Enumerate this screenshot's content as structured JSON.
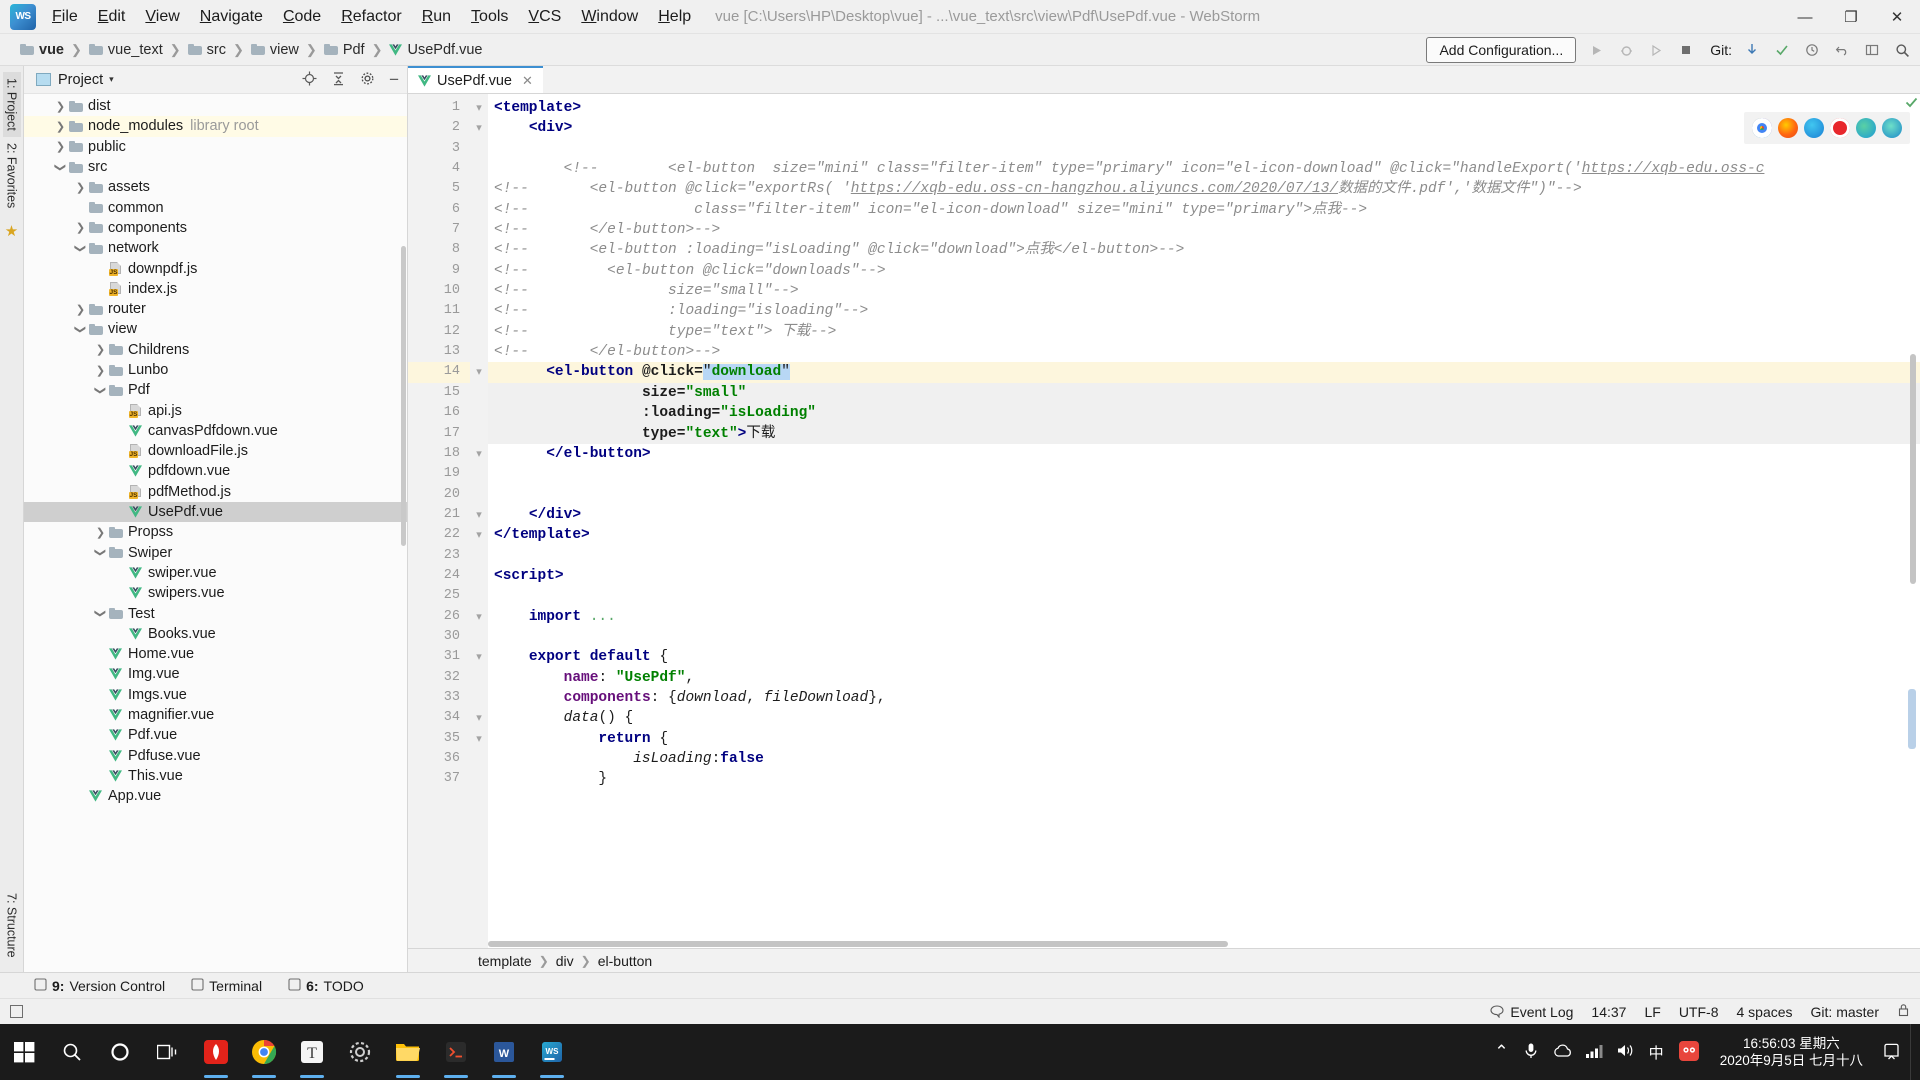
{
  "window": {
    "app_name": "WebStorm",
    "title": "vue [C:\\Users\\HP\\Desktop\\vue] - ...\\vue_text\\src\\view\\Pdf\\UsePdf.vue - WebStorm",
    "logo_text": "WS",
    "minimize": "—",
    "maximize": "❐",
    "close": "✕"
  },
  "menu": [
    "File",
    "Edit",
    "View",
    "Navigate",
    "Code",
    "Refactor",
    "Run",
    "Tools",
    "VCS",
    "Window",
    "Help"
  ],
  "breadcrumb": [
    {
      "label": "vue",
      "icon": "folder-icon",
      "bold": true
    },
    {
      "label": "vue_text",
      "icon": "folder-icon",
      "bold": false
    },
    {
      "label": "src",
      "icon": "folder-icon",
      "bold": false
    },
    {
      "label": "view",
      "icon": "folder-icon",
      "bold": false
    },
    {
      "label": "Pdf",
      "icon": "folder-icon",
      "bold": false
    },
    {
      "label": "UsePdf.vue",
      "icon": "vue-icon",
      "bold": false
    }
  ],
  "toolbar": {
    "add_configuration": "Add Configuration...",
    "run_icon": "run-icon",
    "debug_icon": "debug-icon",
    "coverage_icon": "coverage-icon",
    "stop_icon": "stop-icon",
    "git_label": "Git:",
    "git_update_icon": "update-project-icon",
    "git_commit_icon": "commit-icon",
    "git_history_icon": "history-icon",
    "undo_icon": "undo-icon",
    "layout_icon": "layout-icon",
    "search_icon": "search-icon"
  },
  "left_strip": {
    "tabs": [
      {
        "label": "1: Project",
        "selected": true
      },
      {
        "label": "2: Favorites",
        "selected": false
      }
    ],
    "bottom_tab": "7: Structure",
    "star_icon": "favorites-star-icon"
  },
  "project_panel": {
    "title": "Project",
    "caret": "▾",
    "locate_icon": "locate-icon",
    "collapse_icon": "collapse-all-icon",
    "settings_icon": "gear-icon",
    "hide_icon": "hide-icon",
    "tree": [
      {
        "label": "dist",
        "type": "folder",
        "indent": 1,
        "arrow": "right",
        "state": "normal"
      },
      {
        "label": "node_modules",
        "type": "folder",
        "indent": 1,
        "arrow": "right",
        "state": "highlight",
        "suffix": "library root"
      },
      {
        "label": "public",
        "type": "folder",
        "indent": 1,
        "arrow": "right",
        "state": "normal"
      },
      {
        "label": "src",
        "type": "folder",
        "indent": 1,
        "arrow": "down",
        "state": "normal"
      },
      {
        "label": "assets",
        "type": "folder",
        "indent": 2,
        "arrow": "right",
        "state": "normal"
      },
      {
        "label": "common",
        "type": "folder",
        "indent": 2,
        "arrow": "none",
        "state": "normal"
      },
      {
        "label": "components",
        "type": "folder",
        "indent": 2,
        "arrow": "right",
        "state": "normal"
      },
      {
        "label": "network",
        "type": "folder",
        "indent": 2,
        "arrow": "down",
        "state": "normal"
      },
      {
        "label": "downpdf.js",
        "type": "js",
        "indent": 3,
        "arrow": "none",
        "state": "normal"
      },
      {
        "label": "index.js",
        "type": "js",
        "indent": 3,
        "arrow": "none",
        "state": "normal"
      },
      {
        "label": "router",
        "type": "folder",
        "indent": 2,
        "arrow": "right",
        "state": "normal"
      },
      {
        "label": "view",
        "type": "folder",
        "indent": 2,
        "arrow": "down",
        "state": "normal"
      },
      {
        "label": "Childrens",
        "type": "folder",
        "indent": 3,
        "arrow": "right",
        "state": "normal"
      },
      {
        "label": "Lunbo",
        "type": "folder",
        "indent": 3,
        "arrow": "right",
        "state": "normal"
      },
      {
        "label": "Pdf",
        "type": "folder",
        "indent": 3,
        "arrow": "down",
        "state": "normal"
      },
      {
        "label": "api.js",
        "type": "js",
        "indent": 4,
        "arrow": "none",
        "state": "normal"
      },
      {
        "label": "canvasPdfdown.vue",
        "type": "vue",
        "indent": 4,
        "arrow": "none",
        "state": "normal"
      },
      {
        "label": "downloadFile.js",
        "type": "js",
        "indent": 4,
        "arrow": "none",
        "state": "normal"
      },
      {
        "label": "pdfdown.vue",
        "type": "vue",
        "indent": 4,
        "arrow": "none",
        "state": "normal"
      },
      {
        "label": "pdfMethod.js",
        "type": "js",
        "indent": 4,
        "arrow": "none",
        "state": "normal"
      },
      {
        "label": "UsePdf.vue",
        "type": "vue",
        "indent": 4,
        "arrow": "none",
        "state": "selected"
      },
      {
        "label": "Propss",
        "type": "folder",
        "indent": 3,
        "arrow": "right",
        "state": "normal"
      },
      {
        "label": "Swiper",
        "type": "folder",
        "indent": 3,
        "arrow": "down",
        "state": "normal"
      },
      {
        "label": "swiper.vue",
        "type": "vue",
        "indent": 4,
        "arrow": "none",
        "state": "normal"
      },
      {
        "label": "swipers.vue",
        "type": "vue",
        "indent": 4,
        "arrow": "none",
        "state": "normal"
      },
      {
        "label": "Test",
        "type": "folder",
        "indent": 3,
        "arrow": "down",
        "state": "normal"
      },
      {
        "label": "Books.vue",
        "type": "vue",
        "indent": 4,
        "arrow": "none",
        "state": "normal"
      },
      {
        "label": "Home.vue",
        "type": "vue",
        "indent": 3,
        "arrow": "none",
        "state": "normal"
      },
      {
        "label": "Img.vue",
        "type": "vue",
        "indent": 3,
        "arrow": "none",
        "state": "normal"
      },
      {
        "label": "Imgs.vue",
        "type": "vue",
        "indent": 3,
        "arrow": "none",
        "state": "normal"
      },
      {
        "label": "magnifier.vue",
        "type": "vue",
        "indent": 3,
        "arrow": "none",
        "state": "normal"
      },
      {
        "label": "Pdf.vue",
        "type": "vue",
        "indent": 3,
        "arrow": "none",
        "state": "normal"
      },
      {
        "label": "Pdfuse.vue",
        "type": "vue",
        "indent": 3,
        "arrow": "none",
        "state": "normal"
      },
      {
        "label": "This.vue",
        "type": "vue",
        "indent": 3,
        "arrow": "none",
        "state": "normal"
      },
      {
        "label": "App.vue",
        "type": "vue",
        "indent": 2,
        "arrow": "none",
        "state": "normal"
      }
    ]
  },
  "editor": {
    "tab": {
      "label": "UsePdf.vue",
      "icon": "vue-icon",
      "close": "✕"
    },
    "current_line": 14,
    "breadcrumb": [
      "template",
      "div",
      "el-button"
    ],
    "inspection_ok_icon": "inspection-ok-icon",
    "lines": [
      {
        "n": 1,
        "fold": "-",
        "html": "<span class='tag'>&lt;template&gt;</span>"
      },
      {
        "n": 2,
        "fold": "-",
        "html": "    <span class='tag'>&lt;div&gt;</span>"
      },
      {
        "n": 3,
        "fold": "",
        "html": ""
      },
      {
        "n": 4,
        "fold": "",
        "html": "        <span class='cm'>&lt;!--        &lt;el-button  size=\"mini\" class=\"filter-item\" type=\"primary\" icon=\"el-icon-download\" @click=\"handleExport('<u>https://xqb-edu.oss-c</u></span>"
      },
      {
        "n": 5,
        "fold": "",
        "html": "<span class='cm'>&lt;!--</span>       <span class='cm'>&lt;el-button @click=\"exportRs( '<u>https://xqb-edu.oss-cn-hangzhou.aliyuncs.com/2020/07/13/</u>数据的文件.pdf','数据文件\")\"--&gt;</span>"
      },
      {
        "n": 6,
        "fold": "",
        "html": "<span class='cm'>&lt;!--</span>                   <span class='cm'>class=\"filter-item\" icon=\"el-icon-download\" size=\"mini\" type=\"primary\"&gt;点我--&gt;</span>"
      },
      {
        "n": 7,
        "fold": "",
        "html": "<span class='cm'>&lt;!--</span>       <span class='cm'>&lt;/el-button&gt;--&gt;</span>"
      },
      {
        "n": 8,
        "fold": "",
        "html": "<span class='cm'>&lt;!--</span>       <span class='cm'>&lt;el-button :loading=\"isLoading\" @click=\"download\"&gt;点我&lt;/el-button&gt;--&gt;</span>"
      },
      {
        "n": 9,
        "fold": "",
        "html": "<span class='cm'>&lt;!--</span>         <span class='cm'>&lt;el-button @click=\"downloads\"--&gt;</span>"
      },
      {
        "n": 10,
        "fold": "",
        "html": "<span class='cm'>&lt;!--</span>                <span class='cm'>size=\"small\"--&gt;</span>"
      },
      {
        "n": 11,
        "fold": "",
        "html": "<span class='cm'>&lt;!--</span>                <span class='cm'>:loading=\"isloading\"--&gt;</span>"
      },
      {
        "n": 12,
        "fold": "",
        "html": "<span class='cm'>&lt;!--</span>                <span class='cm'>type=\"text\"&gt; 下载--&gt;</span>"
      },
      {
        "n": 13,
        "fold": "",
        "html": "<span class='cm'>&lt;!--</span>       <span class='cm'>&lt;/el-button&gt;--&gt;</span>"
      },
      {
        "n": 14,
        "fold": "-",
        "current": true,
        "html": "      <span class='tag'>&lt;el-button</span> <span class='attr'>@click=</span><span class='sel-tok'>\"</span><span class='str sel-tok'>download</span><span class='sel-tok'>\"</span>"
      },
      {
        "n": 15,
        "fold": "",
        "shade": true,
        "html": "                 <span class='attr'>size=</span><span class='str'>\"small\"</span>"
      },
      {
        "n": 16,
        "fold": "",
        "shade": true,
        "html": "                 <span class='attr'>:loading=</span><span class='str'>\"isLoading\"</span>"
      },
      {
        "n": 17,
        "fold": "",
        "shade": true,
        "html": "                 <span class='attr'>type=</span><span class='str'>\"text\"</span><span class='tag'>&gt;</span>下载"
      },
      {
        "n": 18,
        "fold": "-",
        "html": "      <span class='tag'>&lt;/el-button&gt;</span>"
      },
      {
        "n": 19,
        "fold": "",
        "html": ""
      },
      {
        "n": 20,
        "fold": "",
        "html": ""
      },
      {
        "n": 21,
        "fold": "-",
        "html": "    <span class='tag'>&lt;/div&gt;</span>"
      },
      {
        "n": 22,
        "fold": "-",
        "html": "<span class='tag'>&lt;/template&gt;</span>"
      },
      {
        "n": 23,
        "fold": "",
        "html": ""
      },
      {
        "n": 24,
        "fold": "",
        "html": "<span class='tag'>&lt;script&gt;</span>"
      },
      {
        "n": 25,
        "fold": "",
        "html": ""
      },
      {
        "n": 26,
        "fold": "-",
        "html": "    <span class='kw'>import</span> <span class='cm' style='font-style:normal;color:#59a869'>...</span>"
      },
      {
        "n": 30,
        "fold": "",
        "html": ""
      },
      {
        "n": 31,
        "fold": "-",
        "html": "    <span class='kw'>export default</span> {"
      },
      {
        "n": 32,
        "fold": "",
        "html": "        <span class='fld'>name</span>: <span class='str'>\"UsePdf\"</span>,"
      },
      {
        "n": 33,
        "fold": "",
        "html": "        <span class='fld'>components</span>: {<span class='ital'>download</span>, <span class='ital'>fileDownload</span>},"
      },
      {
        "n": 34,
        "fold": "-",
        "html": "        <span class='ital'>data</span>() {"
      },
      {
        "n": 35,
        "fold": "-",
        "html": "            <span class='kw'>return</span> {"
      },
      {
        "n": 36,
        "fold": "",
        "html": "                <span class='ital'>isLoading</span>:<span class='kw'>false</span>"
      },
      {
        "n": 37,
        "fold": "",
        "html": "            }"
      }
    ]
  },
  "bottom_tools": [
    {
      "num": "9:",
      "label": "Version Control",
      "icon": "version-control-icon"
    },
    {
      "num": "",
      "label": "Terminal",
      "icon": "terminal-icon"
    },
    {
      "num": "6:",
      "label": "TODO",
      "icon": "todo-icon"
    }
  ],
  "status_bar": {
    "event_log": "Event Log",
    "event_log_icon": "balloon-icon",
    "position": "14:37",
    "line_separator": "LF",
    "encoding": "UTF-8",
    "indent": "4 spaces",
    "branch": "Git: master",
    "lock_icon": "lock-icon"
  },
  "taskbar": {
    "start_icon": "windows-start-icon",
    "items": [
      {
        "name": "search-icon",
        "color": "#ffffff",
        "active": false
      },
      {
        "name": "cortana-icon",
        "color": "#ffffff",
        "active": false
      },
      {
        "name": "task-view-icon",
        "color": "#ffffff",
        "active": false
      },
      {
        "name": "huawei-app-icon",
        "color": "#e2231a",
        "active": true
      },
      {
        "name": "chrome-icon",
        "color": "#4285f4",
        "active": true
      },
      {
        "name": "typora-icon",
        "color": "#3b3b3b",
        "active": true
      },
      {
        "name": "settings-icon",
        "color": "#8d8d8d",
        "active": false
      },
      {
        "name": "file-explorer-icon",
        "color": "#ffc107",
        "active": true
      },
      {
        "name": "git-bash-icon",
        "color": "#f1502f",
        "active": true
      },
      {
        "name": "wps-word-icon",
        "color": "#d24726",
        "active": true
      },
      {
        "name": "webstorm-icon",
        "color": "#29b6d8",
        "active": true
      }
    ],
    "tray": {
      "chevron": "⌃",
      "mic_icon": "microphone-icon",
      "onedrive_icon": "cloud-icon",
      "network_icon": "network-icon",
      "volume_icon": "volume-icon",
      "ime_label": "中",
      "sogou_icon": "sogou-icon"
    },
    "clock": {
      "time": "16:56:03  星期六",
      "date": "2020年9月5日 七月十八"
    },
    "notification_icon": "notification-icon"
  },
  "colors": {
    "accent": "#3d8fd1",
    "vue_green": "#41b883",
    "highlight_row": "#fffbe6",
    "selected_row": "#cfcfcf",
    "current_line": "#fdf6dd",
    "comment": "#8c8c8c",
    "string": "#008000",
    "tag": "#000080"
  }
}
